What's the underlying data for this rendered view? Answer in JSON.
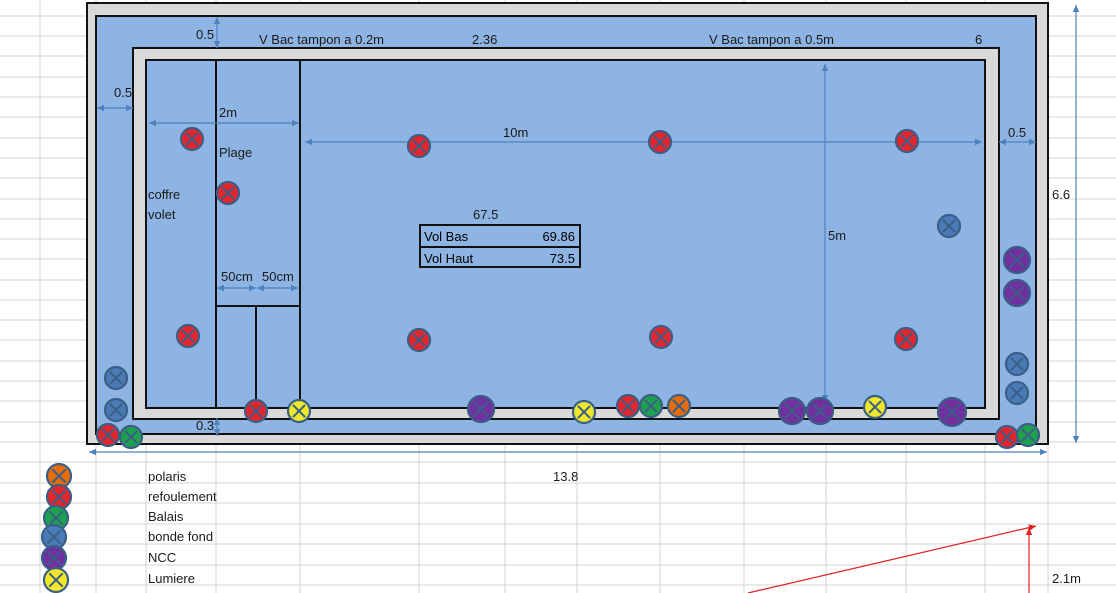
{
  "colors": {
    "water": "#8db4e2",
    "frame": "#d9d9d9",
    "line": "#111111",
    "arrow": "#4f81bd",
    "grid": "#d4d4d4",
    "red_arrow": "#e02020"
  },
  "labels": {
    "top_margin": "0.5",
    "bac_02": "V Bac tampon a 0.2m",
    "val_236": "2.36",
    "bac_05": "V Bac tampon a 0.5m",
    "val_6": "6",
    "left_margin": "0.5",
    "plage_width": "2m",
    "plage": "Plage",
    "length_10m": "10m",
    "right_margin": "0.5",
    "height_66": "6.6",
    "coffre": "coffre",
    "volet": "volet",
    "val_675": "67.5",
    "width_5m": "5m",
    "step_50cm_a": "50cm",
    "step_50cm_b": "50cm",
    "bottom_margin": "0.3",
    "total_length": "13.8",
    "depth_21": "2.1m"
  },
  "volumes": [
    {
      "label": "Vol Bas",
      "value": "69.86"
    },
    {
      "label": "Vol Haut",
      "value": "73.5"
    }
  ],
  "legend": [
    {
      "type": "polaris",
      "label": "polaris",
      "color": "#e46c0a"
    },
    {
      "type": "refoulement",
      "label": "refoulement",
      "color": "#e3262e"
    },
    {
      "type": "balais",
      "label": "Balais",
      "color": "#1fa04f"
    },
    {
      "type": "bonde",
      "label": "bonde fond",
      "color": "#4a7bb7"
    },
    {
      "type": "ncc",
      "label": "NCC",
      "color": "#7030a0"
    },
    {
      "type": "lumiere",
      "label": "Lumiere",
      "color": "#f0e62a"
    }
  ]
}
